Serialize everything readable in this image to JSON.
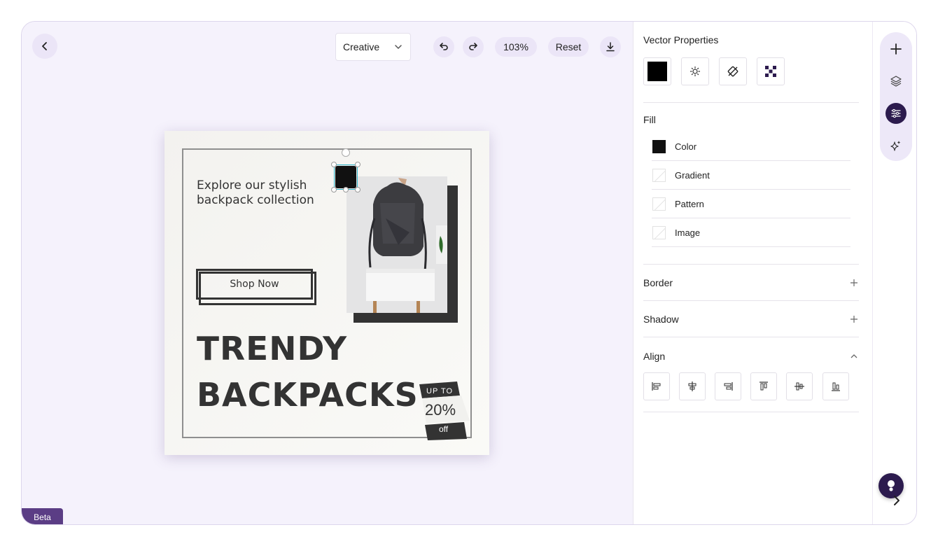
{
  "toolbar": {
    "mode_selected": "Creative",
    "zoom": "103%",
    "reset_label": "Reset"
  },
  "beta_label": "Beta",
  "design": {
    "headline": "Explore our stylish backpack collection",
    "cta_label": "Shop Now",
    "title_line1": "TRENDY",
    "title_line2": "BACKPACKS",
    "badge_top": "UP TO",
    "badge_value": "20%",
    "badge_bottom": "off"
  },
  "panel": {
    "title": "Vector Properties",
    "fill": {
      "title": "Fill",
      "options": [
        {
          "label": "Color",
          "swatch": "#111111"
        },
        {
          "label": "Gradient"
        },
        {
          "label": "Pattern"
        },
        {
          "label": "Image"
        }
      ]
    },
    "border_title": "Border",
    "shadow_title": "Shadow",
    "align_title": "Align"
  },
  "colors": {
    "accent": "#2c1b4e",
    "background": "#f5f2fc",
    "beta_badge": "#5b3d85"
  }
}
